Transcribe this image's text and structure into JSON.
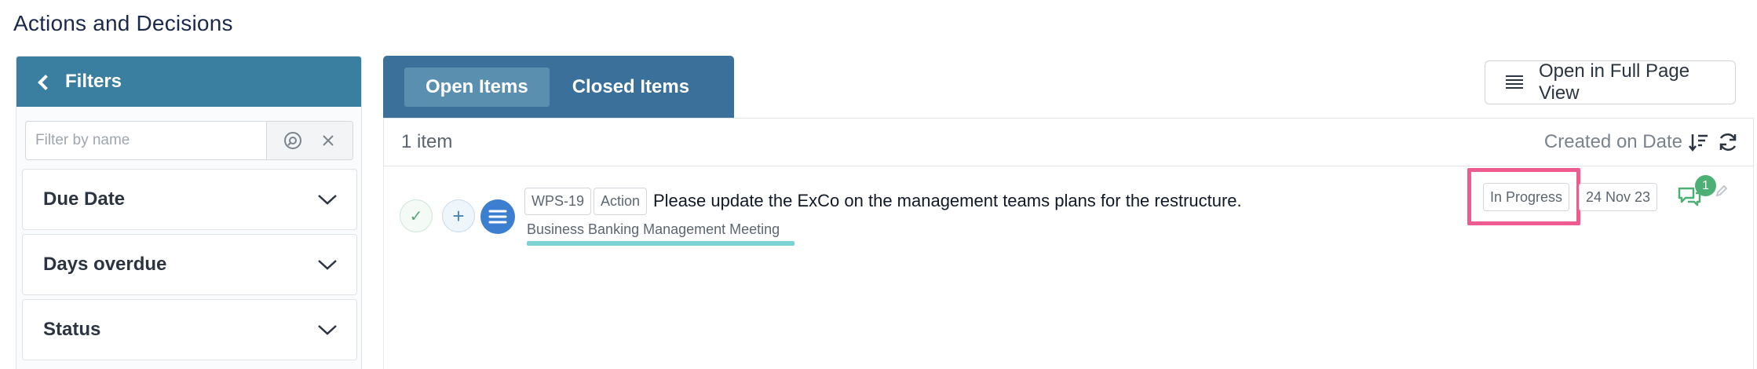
{
  "page": {
    "title": "Actions and Decisions"
  },
  "filters": {
    "header": "Filters",
    "search_placeholder": "Filter by name",
    "sections": [
      {
        "label": "Due Date"
      },
      {
        "label": "Days overdue"
      },
      {
        "label": "Status"
      }
    ]
  },
  "tabs": [
    {
      "label": "Open Items",
      "active": true
    },
    {
      "label": "Closed Items",
      "active": false
    }
  ],
  "toolbar": {
    "full_page_label": "Open in Full Page View"
  },
  "list": {
    "count_label": "1 item",
    "sort_label": "Created on Date",
    "items": [
      {
        "id_tag": "WPS-19",
        "type_tag": "Action",
        "title": "Please update the ExCo on the management teams plans for the restructure.",
        "meeting": "Business Banking Management Meeting",
        "status": "In Progress",
        "date": "24 Nov 23",
        "comment_count": "1"
      }
    ]
  },
  "colors": {
    "header_blue": "#3a7fa0",
    "tab_bar": "#3a7099",
    "highlight_pink": "#ee5b8e",
    "underline_teal": "#7cd3d5",
    "badge_green": "#4caf73"
  }
}
